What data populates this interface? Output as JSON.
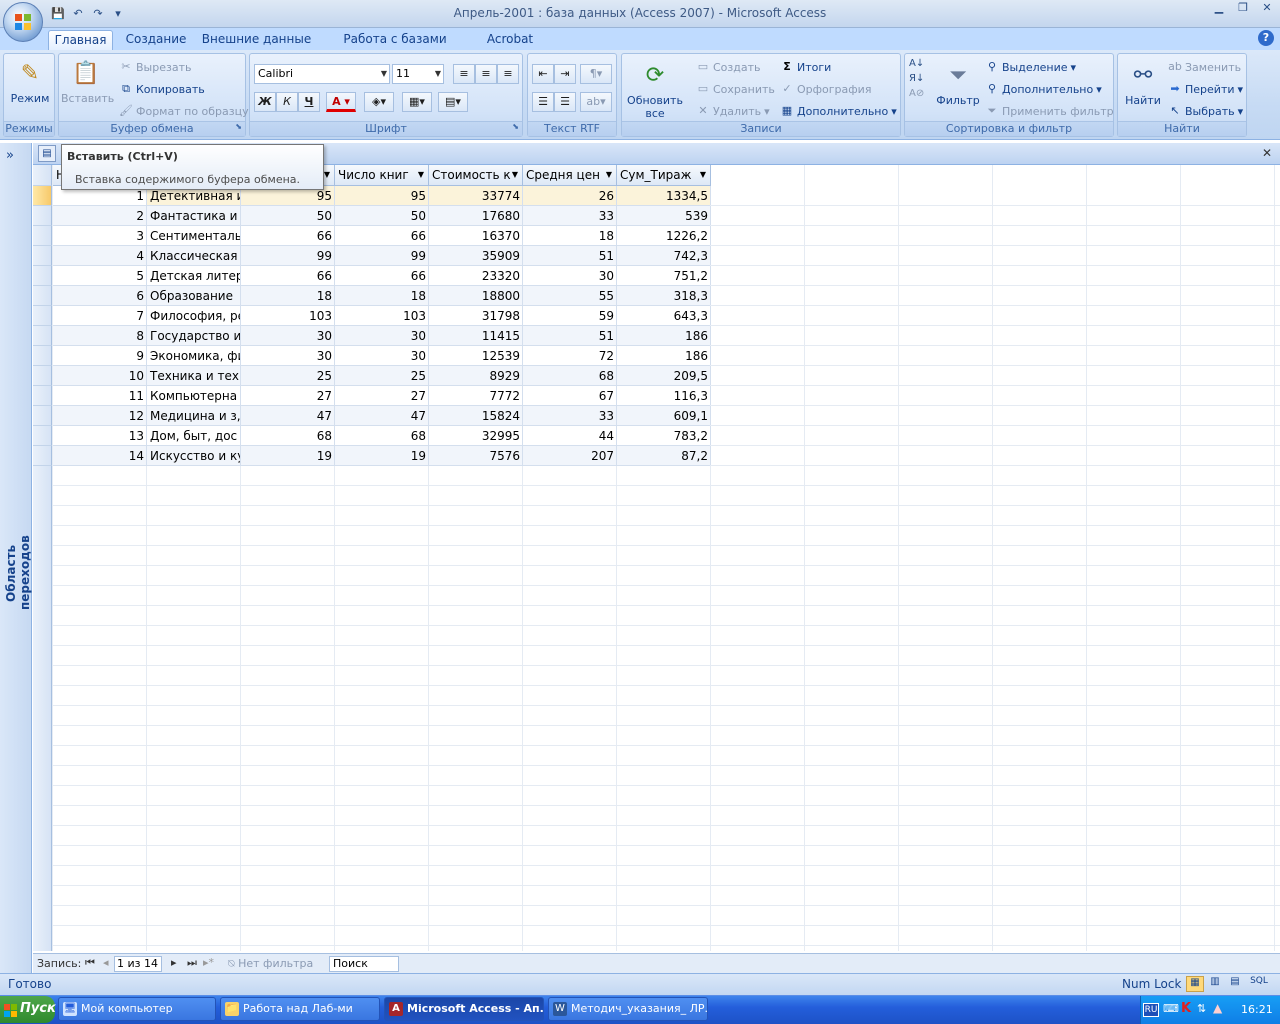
{
  "window": {
    "title": "Апрель-2001 : база данных (Access 2007) - Microsoft Access"
  },
  "tabs": [
    {
      "label": "Главная",
      "active": true
    },
    {
      "label": "Создание"
    },
    {
      "label": "Внешние данные"
    },
    {
      "label": "Работа с базами данных"
    },
    {
      "label": "Acrobat"
    }
  ],
  "ribbon": {
    "modes": {
      "group": "Режимы",
      "view": "Режим"
    },
    "clipboard": {
      "group": "Буфер обмена",
      "paste": "Вставить",
      "cut": "Вырезать",
      "copy": "Копировать",
      "format_painter": "Формат по образцу"
    },
    "font": {
      "group": "Шрифт",
      "family": "Calibri",
      "size": "11",
      "bold": "Ж",
      "italic": "К",
      "underline": "Ч",
      "color_letter": "A"
    },
    "rtf": {
      "group": "Текст RTF"
    },
    "records": {
      "group": "Записи",
      "refresh": "Обновить все",
      "new": "Создать",
      "save": "Сохранить",
      "delete": "Удалить",
      "totals": "Итоги",
      "spelling": "Орфография",
      "more": "Дополнительно"
    },
    "sort": {
      "group": "Сортировка и фильтр",
      "filter": "Фильтр",
      "selection": "Выделение",
      "advanced": "Дополнительно",
      "toggle": "Применить фильтр"
    },
    "find": {
      "group": "Найти",
      "find": "Найти",
      "replace": "Заменить",
      "goto": "Перейти",
      "select": "Выбрать"
    }
  },
  "navpane": {
    "label": "Область переходов",
    "toggle": "»"
  },
  "tooltip": {
    "title": "Вставить (Ctrl+V)",
    "description": "Вставка содержимого буфера обмена."
  },
  "table": {
    "columns": [
      "Н",
      "",
      "Число книг",
      "Стоимость к",
      "Средня цен",
      "Сум_Тираж"
    ],
    "rows": [
      [
        "1",
        "Детективная и",
        "95",
        "95",
        "33774",
        "26",
        "1334,5"
      ],
      [
        "2",
        "Фантастика и п",
        "50",
        "50",
        "17680",
        "33",
        "539"
      ],
      [
        "3",
        "Сентиментальн",
        "66",
        "66",
        "16370",
        "18",
        "1226,2"
      ],
      [
        "4",
        "Классическая",
        "99",
        "99",
        "35909",
        "51",
        "742,3"
      ],
      [
        "5",
        "Детская литер",
        "66",
        "66",
        "23320",
        "30",
        "751,2"
      ],
      [
        "6",
        "Образование",
        "18",
        "18",
        "18800",
        "55",
        "318,3"
      ],
      [
        "7",
        "Философия, ре",
        "103",
        "103",
        "31798",
        "59",
        "643,3"
      ],
      [
        "8",
        "Государство и",
        "30",
        "30",
        "11415",
        "51",
        "186"
      ],
      [
        "9",
        "Экономика, фи",
        "30",
        "30",
        "12539",
        "72",
        "186"
      ],
      [
        "10",
        "Техника и техн",
        "25",
        "25",
        "8929",
        "68",
        "209,5"
      ],
      [
        "11",
        "Компьютерна",
        "27",
        "27",
        "7772",
        "67",
        "116,3"
      ],
      [
        "12",
        "Медицина и з,",
        "47",
        "47",
        "15824",
        "33",
        "609,1"
      ],
      [
        "13",
        "Дом, быт, дос",
        "68",
        "68",
        "32995",
        "44",
        "783,2"
      ],
      [
        "14",
        "Искусство и ку",
        "19",
        "19",
        "7576",
        "207",
        "87,2"
      ]
    ]
  },
  "recordnav": {
    "label": "Запись:",
    "position": "1 из 14",
    "filter": "Нет фильтра",
    "search": "Поиск"
  },
  "status": {
    "left": "Готово",
    "numlock": "Num Lock"
  },
  "taskbar": {
    "start": "Пуск",
    "items": [
      {
        "label": "Мой компьютер"
      },
      {
        "label": "Работа над Лаб-ми"
      },
      {
        "label": "Microsoft Access - Ап...",
        "active": true
      },
      {
        "label": "Методич_указания_ ЛР..."
      }
    ],
    "lang": "RU",
    "clock": "16:21"
  }
}
